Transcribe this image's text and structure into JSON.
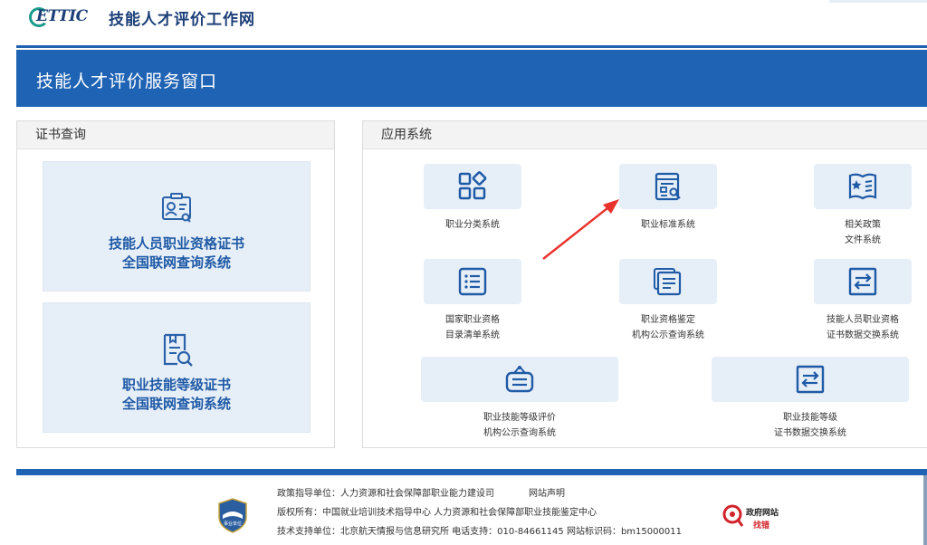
{
  "header": {
    "logo_text": "ETTIC",
    "site_title": "技能人才评价工作网"
  },
  "banner": {
    "title": "技能人才评价服务窗口"
  },
  "cert_panel": {
    "title": "证书查询",
    "cards": [
      {
        "line1": "技能人员职业资格证书",
        "line2": "全国联网查询系统",
        "icon": "certificate-id-icon"
      },
      {
        "line1": "职业技能等级证书",
        "line2": "全国联网查询系统",
        "icon": "document-search-icon"
      }
    ]
  },
  "app_panel": {
    "title": "应用系统",
    "systems": [
      {
        "line1": "职业分类系统",
        "line2": "",
        "icon": "category-grid-icon"
      },
      {
        "line1": "职业标准系统",
        "line2": "",
        "icon": "standard-search-icon"
      },
      {
        "line1": "相关政策",
        "line2": "文件系统",
        "icon": "policy-book-icon"
      },
      {
        "line1": "国家职业资格",
        "line2": "目录清单系统",
        "icon": "list-icon"
      },
      {
        "line1": "职业资格鉴定",
        "line2": "机构公示查询系统",
        "icon": "stacked-docs-icon"
      },
      {
        "line1": "技能人员职业资格",
        "line2": "证书数据交换系统",
        "icon": "exchange-icon"
      },
      {
        "line1": "职业技能等级评价",
        "line2": "机构公示查询系统",
        "icon": "hanging-sign-icon"
      },
      {
        "line1": "职业技能等级",
        "line2": "证书数据交换系统",
        "icon": "exchange-icon"
      }
    ]
  },
  "footer": {
    "guide_unit": "政策指导单位：人力资源和社会保障部职业能力建设司",
    "statement": "网站声明",
    "copyright": "版权所有：中国就业培训技术指导中心  人力资源和社会保障部职业技能鉴定中心",
    "support": "技术支持单位：北京航天情报与信息研究所   电话支持：010-84661145   网站标识码：bm15000011",
    "emblem_text": "事业单位",
    "gov_badge_line1": "政府网站",
    "gov_badge_line2": "找错"
  },
  "colors": {
    "brand_blue": "#1f63b4",
    "tile_bg": "#e6eef7",
    "label_blue": "#1f5aa6",
    "arrow_red": "#e8322b"
  }
}
